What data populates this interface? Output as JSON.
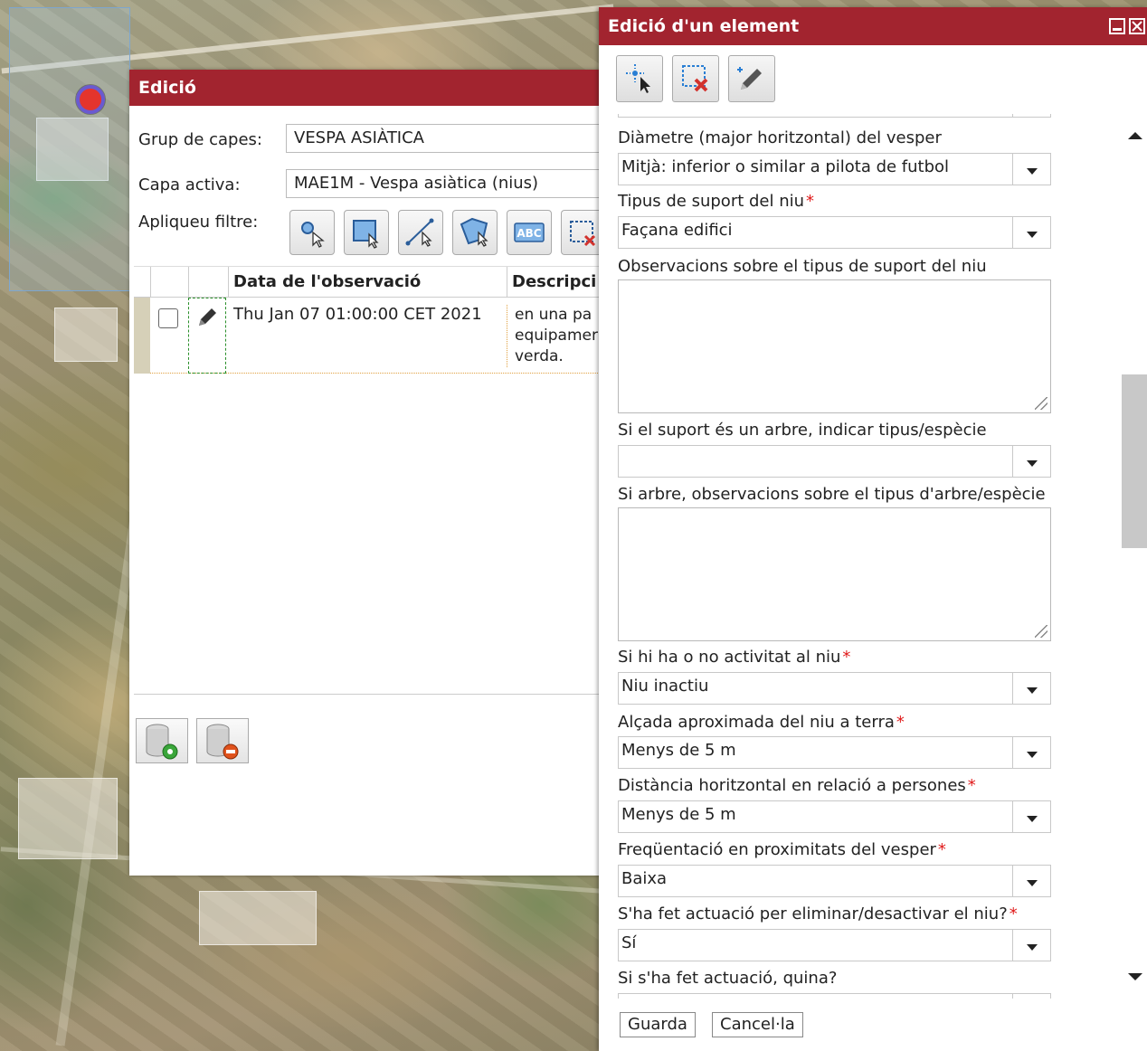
{
  "edicio": {
    "title": "Edició",
    "grup_label": "Grup de capes:",
    "grup_value": "VESPA ASIÀTICA",
    "capa_label": "Capa activa:",
    "capa_value": "MAE1M - Vespa asiàtica (nius)",
    "filtre_label": "Apliqueu filtre:",
    "filter_tools": [
      "point-select-icon",
      "rectangle-select-icon",
      "line-select-icon",
      "polygon-select-icon",
      "text-select-icon",
      "clear-select-icon"
    ],
    "grid": {
      "columns": [
        "Data de l'observació",
        "Descripci"
      ],
      "rows": [
        {
          "date": "Thu Jan 07 01:00:00 CET 2021",
          "desc_line1": "en una pa",
          "desc_line2": "equipamer",
          "desc_line3": "verda."
        }
      ]
    },
    "db_buttons": [
      "add-record-icon",
      "delete-record-icon"
    ]
  },
  "element": {
    "title": "Edició d'un element",
    "toolbar_icons": [
      "select-feature-icon",
      "delete-selection-icon",
      "edit-pencil-icon"
    ],
    "fields": {
      "diametre": {
        "label": "Diàmetre (major horitzontal) del vesper",
        "value": "Mitjà: inferior o similar a pilota de futbol"
      },
      "suport": {
        "label": "Tipus de suport del niu",
        "value": "Façana edifici",
        "required": "*"
      },
      "obs_suport": {
        "label": "Observacions sobre el tipus de suport del niu",
        "value": ""
      },
      "arbre_tipus": {
        "label": "Si el suport és un arbre, indicar tipus/espècie",
        "value": ""
      },
      "obs_arbre": {
        "label": "Si arbre, observacions sobre el tipus d'arbre/espècie",
        "value": ""
      },
      "activitat": {
        "label": "Si hi ha o no activitat al niu",
        "value": "Niu inactiu",
        "required": "*"
      },
      "alcada": {
        "label": "Alçada aproximada del niu a terra",
        "value": "Menys de 5 m",
        "required": "*"
      },
      "distancia": {
        "label": "Distància horitzontal en relació a persones",
        "value": "Menys de 5 m",
        "required": "*"
      },
      "frequentacio": {
        "label": "Freqüentació en proximitats del vesper",
        "value": "Baixa",
        "required": "*"
      },
      "actuacio": {
        "label": "S'ha fet actuació per eliminar/desactivar el niu?",
        "value": "Sí",
        "required": "*"
      },
      "quina": {
        "label": "Si s'ha fet actuació, quina?",
        "value": ""
      }
    },
    "buttons": {
      "save": "Guarda",
      "cancel": "Cancel·la"
    }
  },
  "colors": {
    "titlebar": "#a2242f",
    "required": "#e01a1a"
  }
}
